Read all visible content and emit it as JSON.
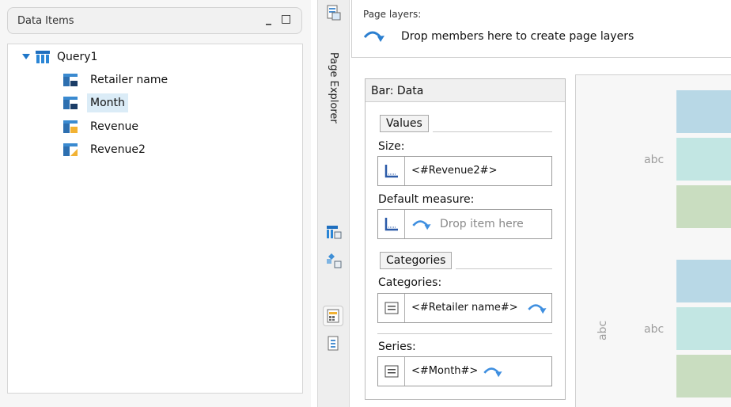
{
  "left_panel": {
    "title": "Data Items",
    "minimize_glyph": "_",
    "maximize_glyph": "□",
    "tree": {
      "root": {
        "label": "Query1",
        "expanded": true,
        "icon": "query-table-icon"
      },
      "items": [
        {
          "label": "Retailer name",
          "icon": "data-item-level-icon",
          "selected": false
        },
        {
          "label": "Month",
          "icon": "data-item-level-icon",
          "selected": true
        },
        {
          "label": "Revenue",
          "icon": "measure-icon",
          "selected": false
        },
        {
          "label": "Revenue2",
          "icon": "calculated-measure-icon",
          "selected": false
        }
      ]
    }
  },
  "strip": {
    "tab_label": "Page Explorer",
    "icons": [
      "page-explorer-icon",
      "insertable-objects-icon",
      "query-explorer-icon",
      "properties-icon",
      "page-structure-icon"
    ]
  },
  "page_layers": {
    "title": "Page layers:",
    "drop_text": "Drop members here to create page layers"
  },
  "bar_panel": {
    "title": "Bar: Data",
    "values_tab": "Values",
    "size_label": "Size:",
    "size_value": "<#Revenue2#>",
    "default_measure_label": "Default measure:",
    "default_measure_hint": "Drop item here",
    "categories_tab": "Categories",
    "categories_label": "Categories:",
    "categories_value": "<#Retailer name#>",
    "series_label": "Series:",
    "series_value": "<#Month#>"
  },
  "chart_preview": {
    "category_labels": [
      "abc",
      "abc"
    ],
    "axis_label": "abc",
    "bar_colors": [
      "#b8d8e6",
      "#c2e6e3",
      "#c9ddc0"
    ]
  }
}
